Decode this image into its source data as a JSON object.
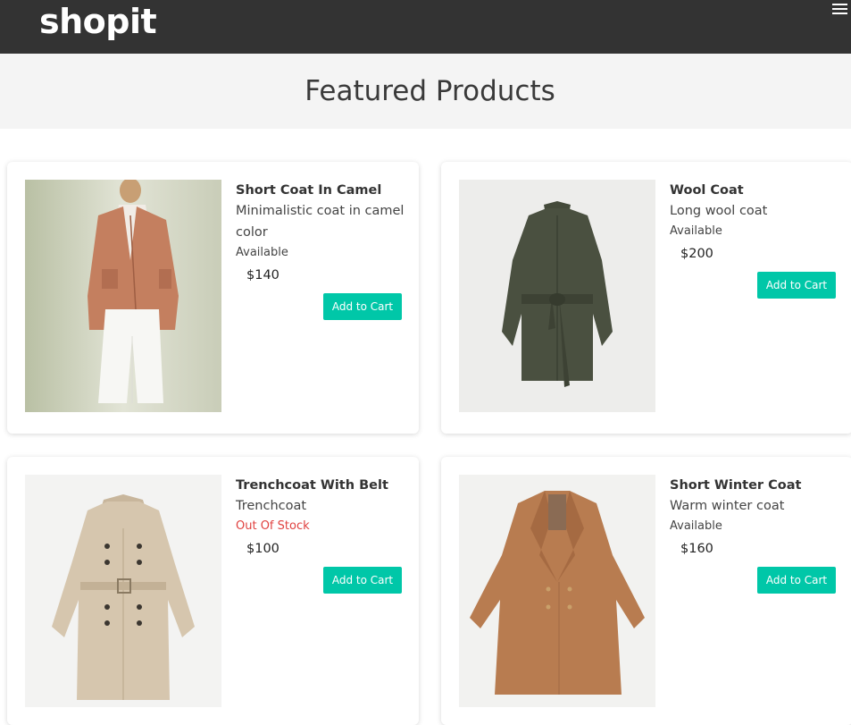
{
  "navbar": {
    "brand": "shopit",
    "menu_icon": "hamburger-icon"
  },
  "hero": {
    "title": "Featured Products"
  },
  "colors": {
    "navbar_bg": "#333333",
    "hero_bg": "#f4f4f4",
    "accent": "#00c7a8",
    "out_of_stock": "#e0413f"
  },
  "products": [
    {
      "name": "Short Coat In Camel",
      "description": "Minimalistic coat in camel color",
      "status": "Available",
      "price": "$140",
      "button_label": "Add to Cart"
    },
    {
      "name": "Wool Coat",
      "description": "Long wool coat",
      "status": "Available",
      "price": "$200",
      "button_label": "Add to Cart"
    },
    {
      "name": "Trenchcoat With Belt",
      "description": "Trenchcoat",
      "status": "Out Of Stock",
      "price": "$100",
      "button_label": "Add to Cart"
    },
    {
      "name": "Short Winter Coat",
      "description": "Warm winter coat",
      "status": "Available",
      "price": "$160",
      "button_label": "Add to Cart"
    }
  ]
}
